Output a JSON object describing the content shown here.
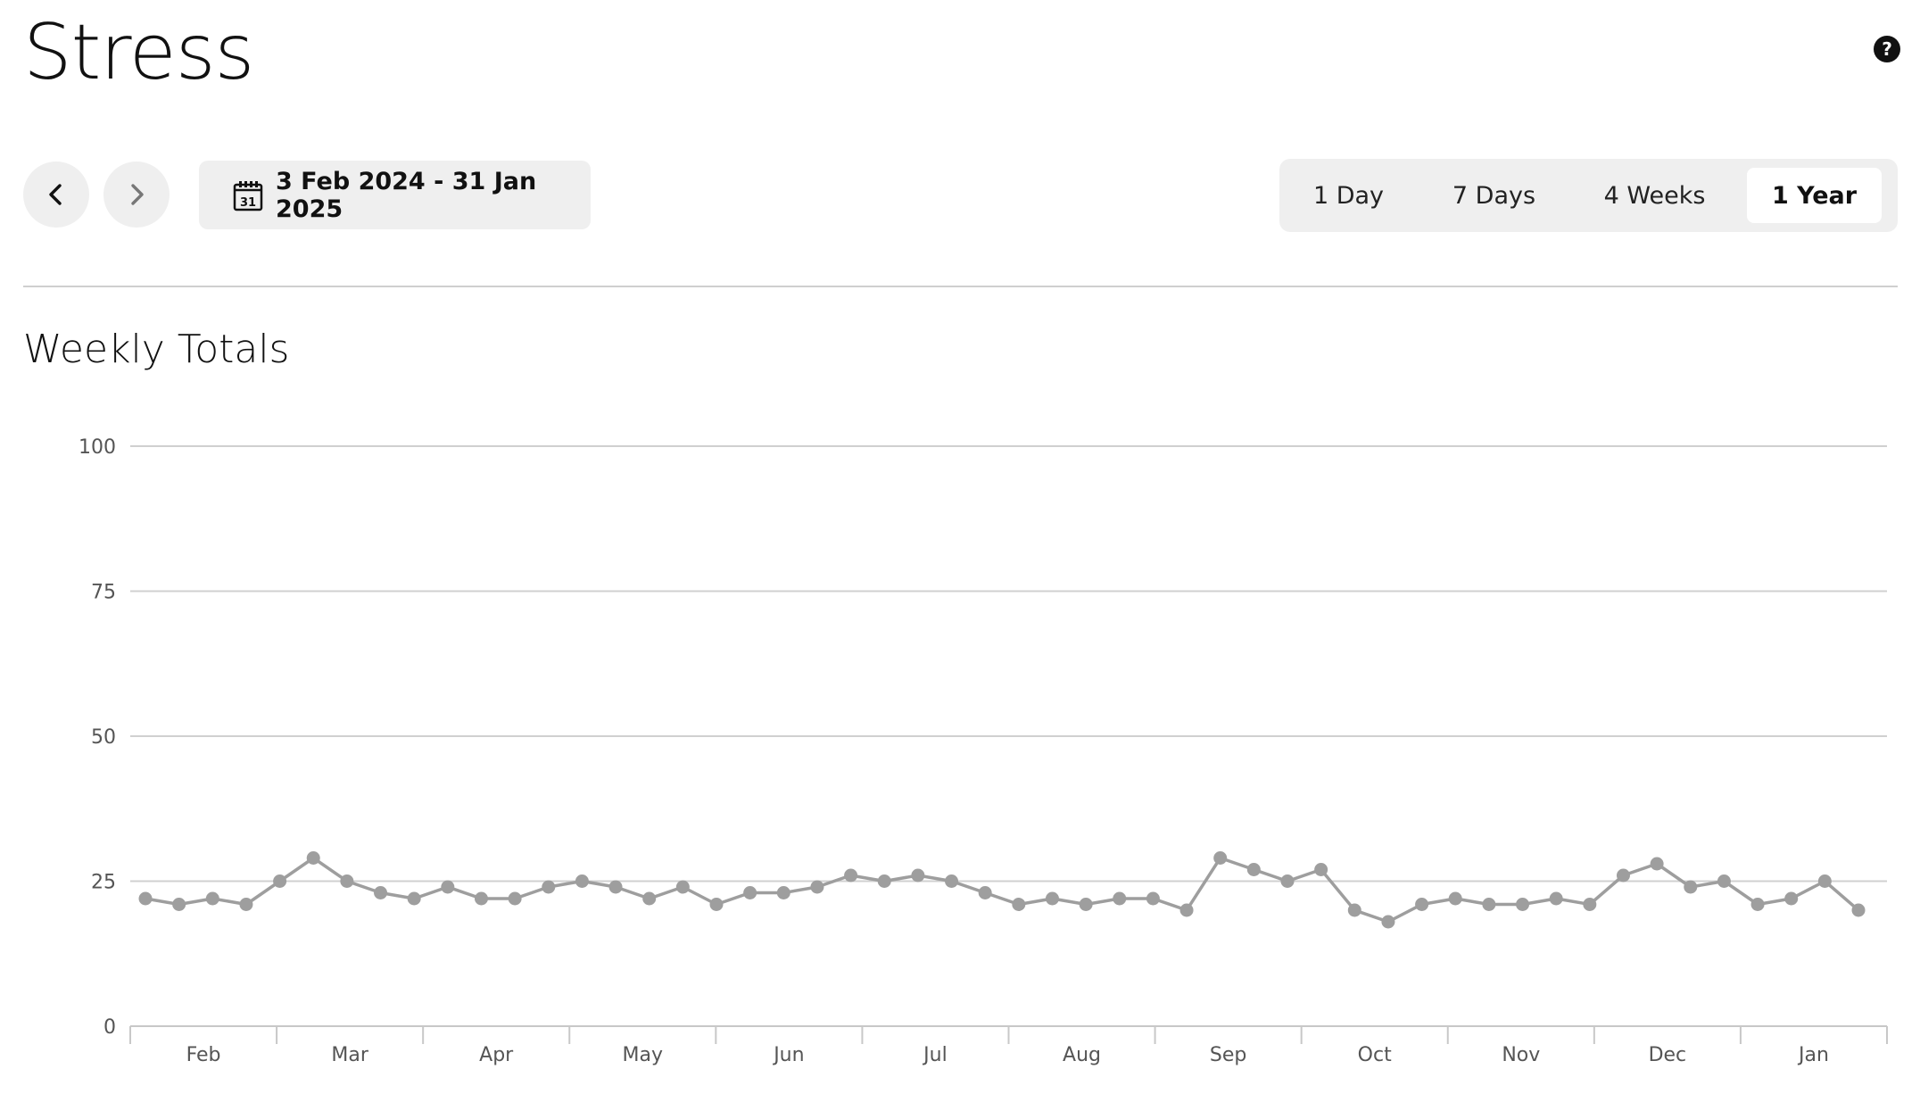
{
  "header": {
    "title": "Stress",
    "help_icon": "question-circle-icon"
  },
  "toolbar": {
    "prev_icon": "chevron-left-icon",
    "next_icon": "chevron-right-icon",
    "calendar_icon": "calendar-icon",
    "calendar_day": "31",
    "date_range": "3 Feb 2024 - 31 Jan 2025",
    "periods": [
      {
        "label": "1 Day",
        "active": false
      },
      {
        "label": "7 Days",
        "active": false
      },
      {
        "label": "4 Weeks",
        "active": false
      },
      {
        "label": "1 Year",
        "active": true
      }
    ]
  },
  "section": {
    "title": "Weekly Totals"
  },
  "chart_data": {
    "type": "line",
    "ylim": [
      0,
      100
    ],
    "yticks": [
      0,
      25,
      50,
      75,
      100
    ],
    "grid": true,
    "x_tick_labels": [
      "Feb",
      "Mar",
      "Apr",
      "May",
      "Jun",
      "Jul",
      "Aug",
      "Sep",
      "Oct",
      "Nov",
      "Dec",
      "Jan"
    ],
    "values": [
      22,
      21,
      22,
      21,
      25,
      29,
      25,
      23,
      22,
      24,
      22,
      22,
      24,
      25,
      24,
      22,
      24,
      21,
      23,
      23,
      24,
      26,
      25,
      26,
      25,
      23,
      21,
      22,
      21,
      22,
      22,
      20,
      29,
      27,
      25,
      27,
      20,
      18,
      21,
      22,
      21,
      21,
      22,
      21,
      26,
      28,
      24,
      25,
      21,
      22,
      25,
      20
    ],
    "line_color": "#9e9e9e",
    "grid_color": "#d0d0d0"
  }
}
